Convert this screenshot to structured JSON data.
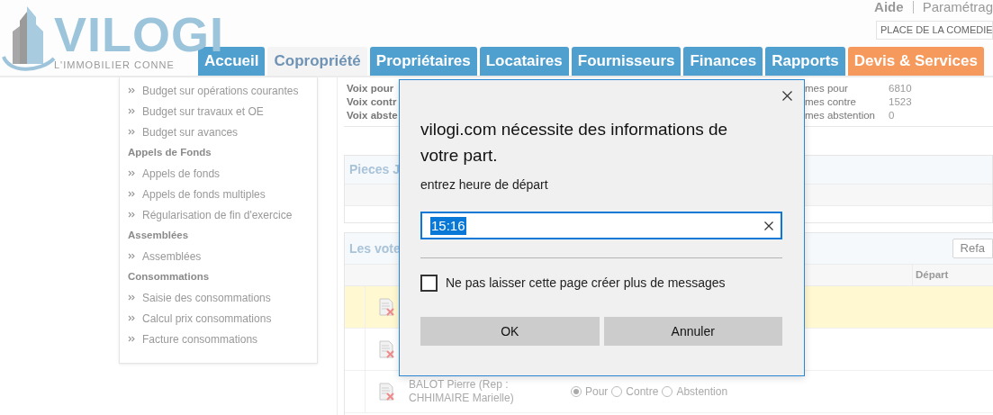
{
  "header": {
    "logo": {
      "name": "VILOGI",
      "tagline": "L'IMMOBILIER CONNE"
    },
    "top_links": [
      "Aide",
      "Paramétrag"
    ],
    "search": {
      "value": "PLACE DE LA COMEDIE"
    }
  },
  "tabs": [
    {
      "label": "Accueil",
      "selected": false,
      "kind": "normal"
    },
    {
      "label": "Copropriété",
      "selected": true,
      "kind": "normal"
    },
    {
      "label": "Propriétaires",
      "selected": false,
      "kind": "normal"
    },
    {
      "label": "Locataires",
      "selected": false,
      "kind": "normal"
    },
    {
      "label": "Fournisseurs",
      "selected": false,
      "kind": "normal"
    },
    {
      "label": "Finances",
      "selected": false,
      "kind": "normal"
    },
    {
      "label": "Rapports",
      "selected": false,
      "kind": "normal"
    },
    {
      "label": "Devis & Services",
      "selected": false,
      "kind": "highlight"
    }
  ],
  "sidebar": {
    "items": [
      {
        "kind": "link",
        "label": "Budget sur opérations courantes"
      },
      {
        "kind": "link",
        "label": "Budget sur travaux et OE"
      },
      {
        "kind": "link",
        "label": "Budget sur avances"
      },
      {
        "kind": "heading",
        "label": "Appels de Fonds"
      },
      {
        "kind": "link",
        "label": "Appels de fonds"
      },
      {
        "kind": "link",
        "label": "Appels de fonds multiples"
      },
      {
        "kind": "link",
        "label": "Régularisation de fin d'exercice"
      },
      {
        "kind": "heading",
        "label": "Assemblées"
      },
      {
        "kind": "link",
        "label": "Assemblées"
      },
      {
        "kind": "heading",
        "label": "Consommations"
      },
      {
        "kind": "link",
        "label": "Saisie des consommations"
      },
      {
        "kind": "link",
        "label": "Calcul prix consommations"
      },
      {
        "kind": "link",
        "label": "Facture consommations"
      }
    ]
  },
  "votes_summary": {
    "left": [
      "Voix pour",
      "Voix contr",
      "Voix abste"
    ],
    "right": [
      {
        "label": "mes pour",
        "value": "6810"
      },
      {
        "label": "mes contre",
        "value": "1523"
      },
      {
        "label": "mes abstention",
        "value": "0"
      }
    ]
  },
  "attachments_panel": {
    "title": "Pieces J"
  },
  "votes_panel": {
    "title": "Les vote",
    "refresh_button": "Refa",
    "columns": [
      {
        "label": "Départ"
      }
    ],
    "rows": [
      {
        "highlighted": true
      },
      {
        "highlighted": false
      },
      {
        "highlighted": false,
        "name": "BALOT Pierre (Rep : CHHIMAIRE Marielle)",
        "options": [
          {
            "label": "Pour",
            "selected": true
          },
          {
            "label": "Contre",
            "selected": false
          },
          {
            "label": "Abstention",
            "selected": false
          }
        ]
      }
    ]
  },
  "dialog": {
    "title": "vilogi.com nécessite des informations de votre part.",
    "prompt": "entrez heure de départ",
    "input_value": "15:16",
    "checkbox": {
      "label": "Ne pas laisser cette page créer plus de messages",
      "checked": false
    },
    "buttons": [
      "OK",
      "Annuler"
    ]
  }
}
